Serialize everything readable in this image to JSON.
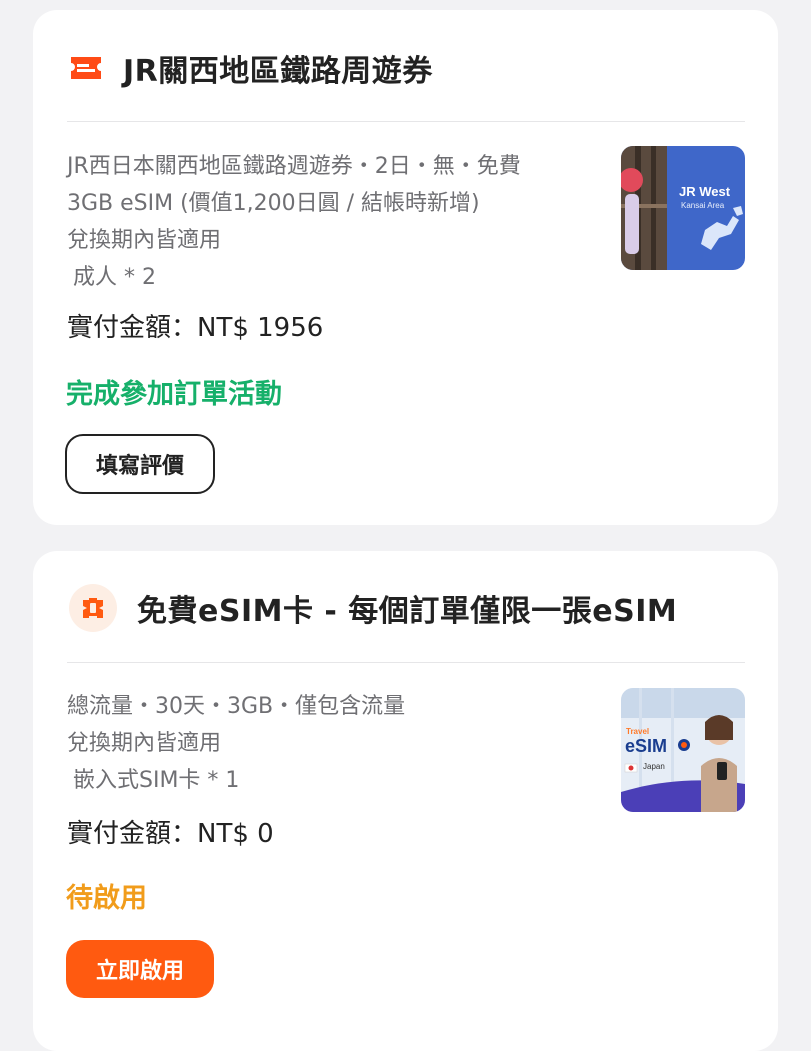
{
  "orders": [
    {
      "title": "JR關西地區鐵路周遊券",
      "icon": "ticket-icon",
      "details": [
        "JR西日本關西地區鐵路週遊券・2日・無・免費",
        "3GB eSIM (價值1,200日圓 / 結帳時新增)",
        "兌換期內皆適用"
      ],
      "quantity": "成人 * 2",
      "price": "實付金額：NT$ 1956",
      "status": "完成參加訂單活動",
      "status_color": "#16b06a",
      "action": "填寫評價",
      "thumb": {
        "line1": "JR West",
        "line2": "Kansai Area"
      }
    },
    {
      "title": "免費eSIM卡 - 每個訂單僅限一張eSIM",
      "icon": "esim-icon",
      "details": [
        "總流量・30天・3GB・僅包含流量",
        "兌換期內皆適用"
      ],
      "quantity": "嵌入式SIM卡 * 1",
      "price": "實付金額：NT$ 0",
      "status": "待啟用",
      "status_color": "#f19c1b",
      "action": "立即啟用",
      "action_color": "#ff5a10",
      "thumb": {
        "small": "Travel",
        "brand": "eSIM",
        "country": "Japan"
      }
    }
  ]
}
